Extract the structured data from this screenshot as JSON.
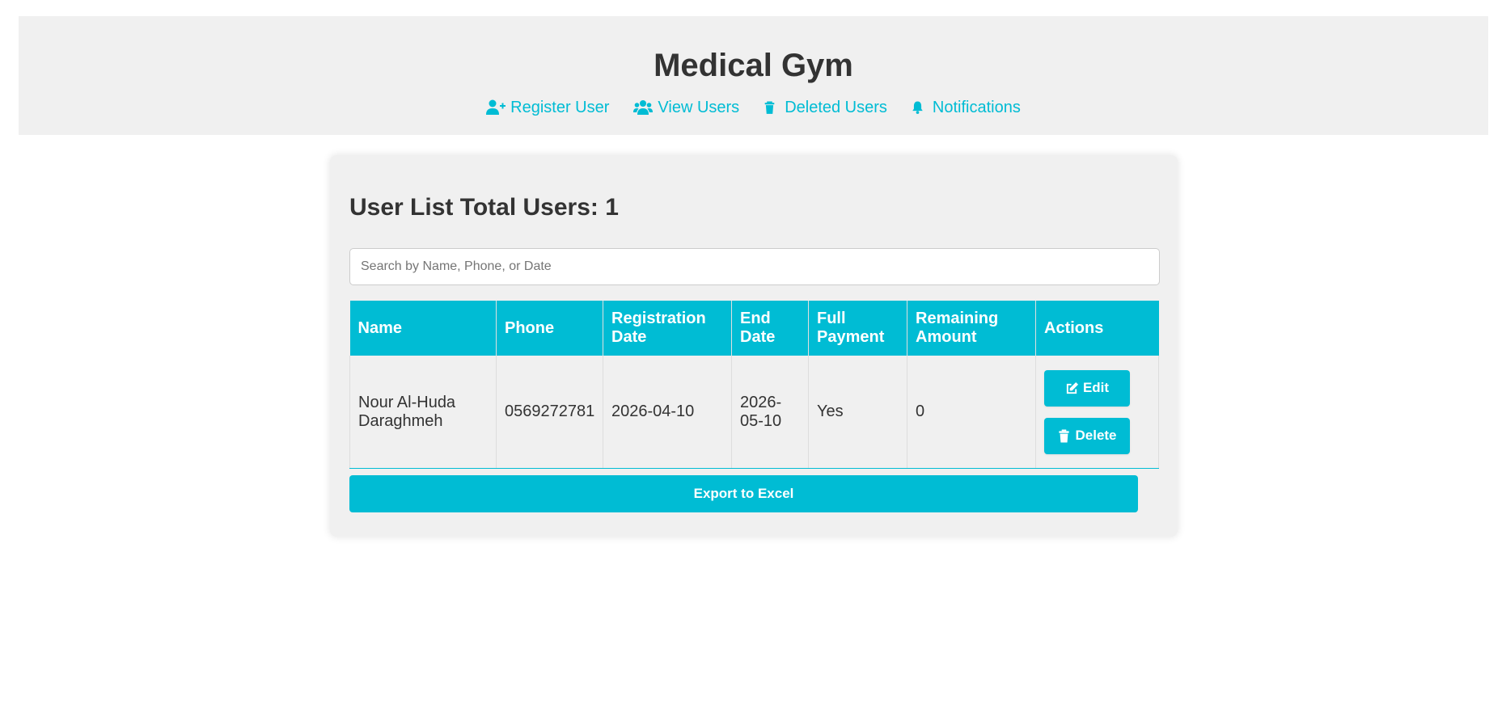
{
  "header": {
    "title": "Medical Gym",
    "nav": [
      {
        "label": "Register User",
        "icon": "user-plus-icon"
      },
      {
        "label": "View Users",
        "icon": "users-icon"
      },
      {
        "label": "Deleted Users",
        "icon": "trash-icon"
      },
      {
        "label": "Notifications",
        "icon": "bell-icon"
      }
    ]
  },
  "main": {
    "title": "User List Total Users: 1",
    "search_placeholder": "Search by Name, Phone, or Date",
    "search_value": "",
    "table": {
      "columns": [
        "Name",
        "Phone",
        "Registration Date",
        "End Date",
        "Full Payment",
        "Remaining Amount",
        "Actions"
      ],
      "rows": [
        {
          "name": "Nour Al-Huda Daraghmeh",
          "phone": "0569272781",
          "registration_date": "2026-04-10",
          "end_date": "2026-05-10",
          "full_payment": "Yes",
          "remaining_amount": "0",
          "edit_label": "Edit",
          "delete_label": "Delete"
        }
      ]
    },
    "export_label": "Export to Excel"
  },
  "colors": {
    "accent": "#00bcd4",
    "panel": "#f0f0f0",
    "text": "#333333"
  }
}
